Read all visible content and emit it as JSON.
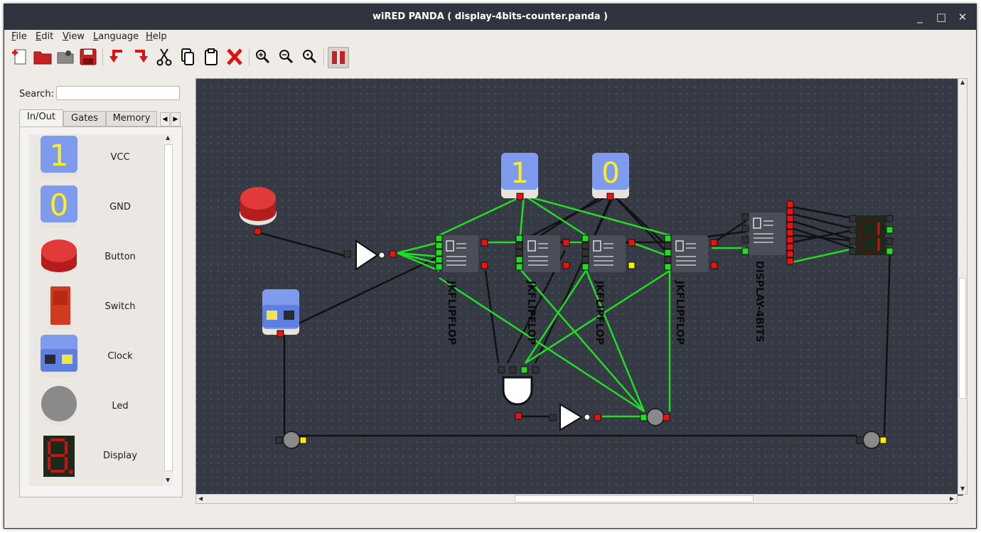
{
  "window": {
    "title": "wiRED PANDA ( display-4bits-counter.panda )",
    "controls": {
      "minimize": "_",
      "maximize": "□",
      "close": "✕"
    }
  },
  "menu": [
    {
      "label": "File",
      "u": "F",
      "rest": "ile"
    },
    {
      "label": "Edit",
      "u": "E",
      "rest": "dit"
    },
    {
      "label": "View",
      "u": "V",
      "rest": "iew"
    },
    {
      "label": "Language",
      "u": "L",
      "rest": "anguage"
    },
    {
      "label": "Help",
      "u": "H",
      "rest": "elp"
    }
  ],
  "toolbar": {
    "icons": [
      "new-file-icon",
      "open-folder-icon",
      "open-recent-icon",
      "save-icon",
      "undo-icon",
      "redo-icon",
      "cut-icon",
      "copy-icon",
      "paste-icon",
      "delete-icon",
      "zoom-in-icon",
      "zoom-out-icon",
      "zoom-reset-icon",
      "pause-simulation-icon"
    ]
  },
  "sidebar": {
    "search_label": "Search:",
    "search_value": "",
    "tabs": [
      "In/Out",
      "Gates",
      "Memory"
    ],
    "active_tab": "In/Out",
    "components": [
      {
        "label": "VCC",
        "icon": "vcc-icon"
      },
      {
        "label": "GND",
        "icon": "gnd-icon"
      },
      {
        "label": "Button",
        "icon": "button-icon"
      },
      {
        "label": "Switch",
        "icon": "switch-icon"
      },
      {
        "label": "Clock",
        "icon": "clock-icon"
      },
      {
        "label": "Led",
        "icon": "led-icon"
      },
      {
        "label": "Display",
        "icon": "display-icon"
      }
    ]
  },
  "canvas": {
    "vcc_text": "1",
    "gnd_text": "0",
    "ff_label": "JKFLIPFLOP",
    "display_label": "DISPLAY-4BITS",
    "colors": {
      "background": "#363a45",
      "wire_active": "#22dd22",
      "wire_inactive": "#111111",
      "port_on": "#22dd22",
      "port_off": "#ee1111",
      "port_neutral": "#333333",
      "port_yellow": "#ffee00"
    }
  }
}
